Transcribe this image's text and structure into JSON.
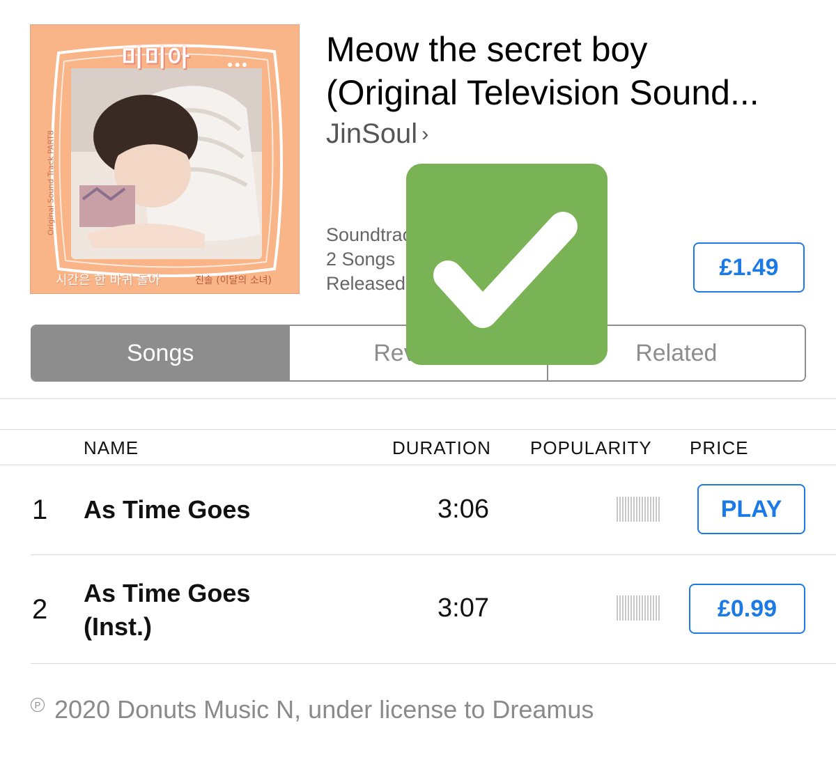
{
  "album": {
    "title_line1": "Meow the secret boy",
    "title_line2": "(Original Television Sound...",
    "artist": "JinSoul",
    "artist_chevron": "›",
    "genre": "Soundtrack",
    "song_count": "2 Songs",
    "released": "Released",
    "price": "£1.49",
    "art": {
      "logo_text": "미미아",
      "paws": "●●●",
      "side_text": "Original Sound Track PART8",
      "bottom_left": "시간은 한 바퀴 돌아",
      "bottom_right": "진솔 (이달의 소녀)"
    }
  },
  "tabs": [
    {
      "label": "Songs",
      "active": true
    },
    {
      "label": "Reviews",
      "active": false
    },
    {
      "label": "Related",
      "active": false
    }
  ],
  "table": {
    "headers": {
      "name": "NAME",
      "duration": "DURATION",
      "popularity": "POPULARITY",
      "price": "PRICE"
    },
    "rows": [
      {
        "num": "1",
        "name_line1": "As Time Goes",
        "name_line2": "",
        "duration": "3:06",
        "popularity": 0,
        "action": "PLAY"
      },
      {
        "num": "2",
        "name_line1": "As Time Goes",
        "name_line2": "(Inst.)",
        "duration": "3:07",
        "popularity": 0,
        "action": "£0.99"
      }
    ]
  },
  "footer": {
    "p_mark": "P",
    "copyright": "2020 Donuts Music N, under license to Dreamus"
  },
  "overlay": {
    "icon": "checkmark-icon",
    "color": "#7ab356"
  },
  "colors": {
    "accent": "#1b7ae5",
    "segment": "#8d8d8d"
  }
}
